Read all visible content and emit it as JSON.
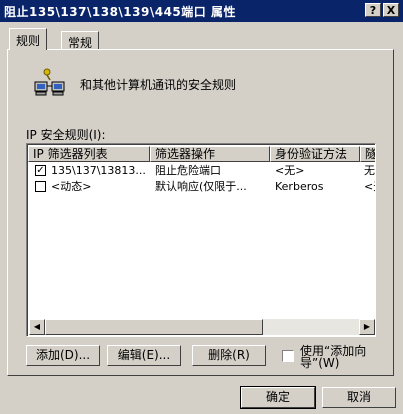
{
  "window": {
    "title": "阻止135\\137\\138\\139\\445端口   属性",
    "help_button": "?",
    "close_button": "X"
  },
  "tabs": [
    {
      "label": "规则",
      "active": true
    },
    {
      "label": "常规",
      "active": false
    }
  ],
  "panel": {
    "description": "和其他计算机通讯的安全规则",
    "list_label": "IP 安全规则(I):",
    "columns": [
      "IP 筛选器列表",
      "筛选器操作",
      "身份验证方法",
      "隧"
    ],
    "rows": [
      {
        "checked": true,
        "filter_list": "135\\137\\13813...",
        "action": "阻止危险端口",
        "auth": "<无>",
        "tunnel": "无"
      },
      {
        "checked": false,
        "filter_list": "<动态>",
        "action": "默认响应(仅限于...",
        "auth": "Kerberos",
        "tunnel": "<无"
      }
    ],
    "buttons": {
      "add": "添加(D)...",
      "edit": "编辑(E)...",
      "remove": "删除(R)"
    },
    "wizard_checkbox": {
      "label": "使用“添加向导”(W)",
      "checked": false
    }
  },
  "footer": {
    "ok": "确定",
    "cancel": "取消"
  }
}
